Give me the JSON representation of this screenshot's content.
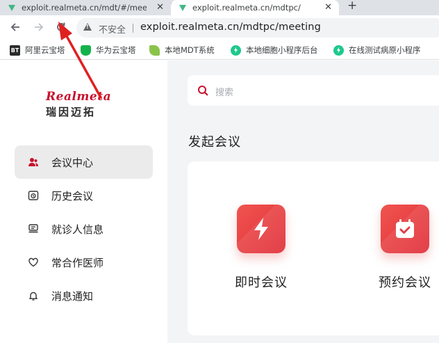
{
  "browser": {
    "tabs": [
      {
        "title": "exploit.realmeta.cn/mdt/#/meeting",
        "active": false
      },
      {
        "title": "exploit.realmeta.cn/mdtpc/",
        "active": true
      }
    ],
    "new_tab_symbol": "+",
    "close_symbol": "✕",
    "security_label": "不安全",
    "url": "exploit.realmeta.cn/mdtpc/meeting",
    "bookmarks": [
      {
        "label": "阿里云宝塔",
        "icon": "bt-icon",
        "badge": "BT"
      },
      {
        "label": "华为云宝塔",
        "icon": "shield-icon"
      },
      {
        "label": "本地MDT系统",
        "icon": "leaf-icon"
      },
      {
        "label": "本地细胞小程序后台",
        "icon": "bolt-icon"
      },
      {
        "label": "在线测试病原小程序",
        "icon": "bolt-icon"
      }
    ]
  },
  "sidebar": {
    "logo": {
      "text_en": "Realmeta",
      "text_cn": "瑞因迈拓"
    },
    "items": [
      {
        "label": "会议中心",
        "icon": "user-group-icon",
        "active": true
      },
      {
        "label": "历史会议",
        "icon": "history-icon",
        "active": false
      },
      {
        "label": "就诊人信息",
        "icon": "patient-card-icon",
        "active": false
      },
      {
        "label": "常合作医师",
        "icon": "heart-icon",
        "active": false
      },
      {
        "label": "消息通知",
        "icon": "bell-icon",
        "active": false
      }
    ]
  },
  "main": {
    "search_placeholder": "搜索",
    "section_title": "发起会议",
    "actions": [
      {
        "label": "即时会议",
        "icon": "lightning-icon"
      },
      {
        "label": "预约会议",
        "icon": "calendar-check-icon"
      }
    ]
  },
  "colors": {
    "accent": "#e0303a",
    "annotation_arrow": "#e02020",
    "sidebar_active_bg": "#ebebeb",
    "main_bg": "#f3f4f6"
  }
}
